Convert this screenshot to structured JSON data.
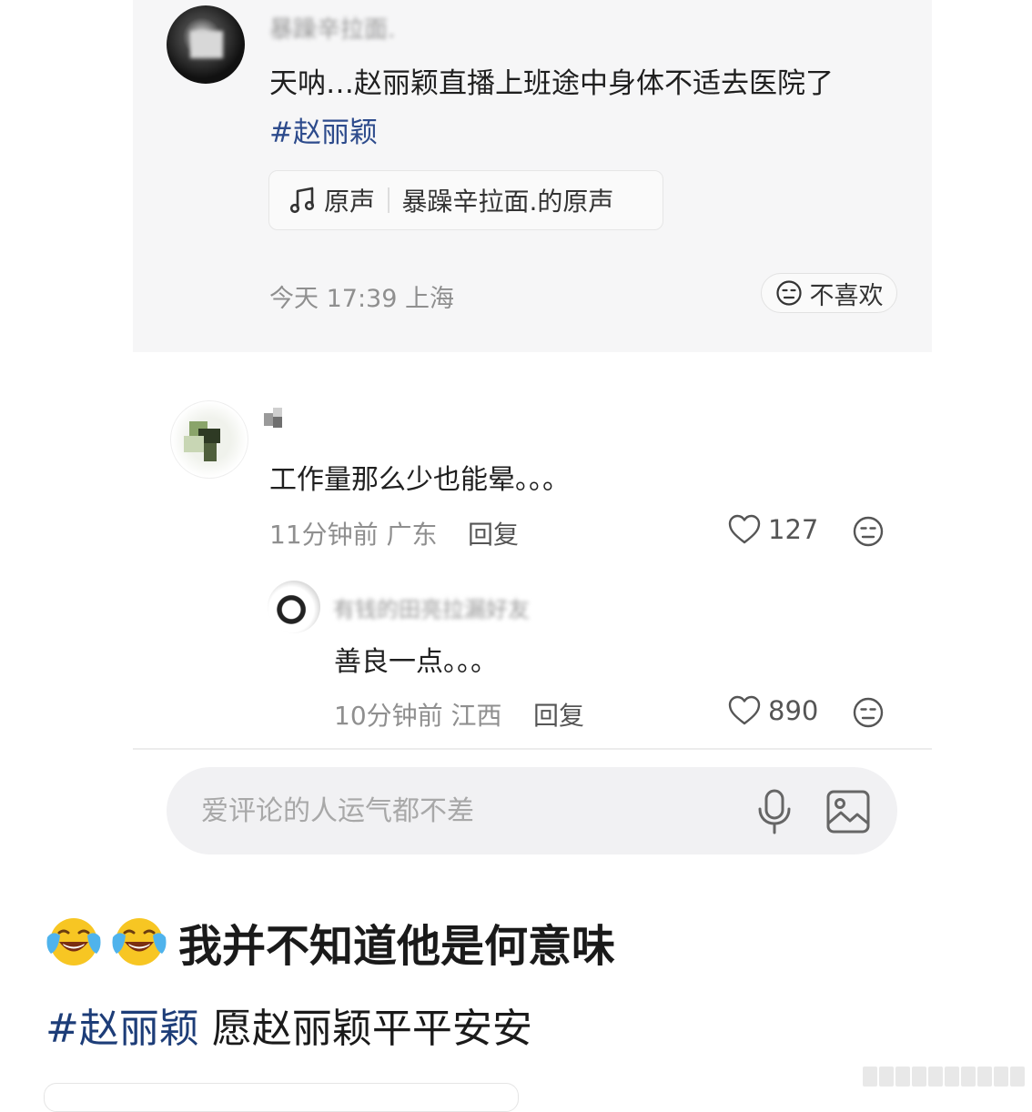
{
  "post": {
    "username": "暴躁辛拉面.",
    "text": "天呐…赵丽颖直播上班途中身体不适去医院了",
    "hashtag": "#赵丽颖",
    "sound_tag": "原声",
    "sound_name": "暴躁辛拉面.的原声",
    "meta": "今天 17:39 上海",
    "dislike_label": "不喜欢"
  },
  "comments": [
    {
      "text": "工作量那么少也能晕。。。",
      "meta": "11分钟前 广东",
      "reply_label": "回复",
      "likes": "127",
      "replies": [
        {
          "username": "有钱的田亮拉漏好友",
          "text": "善良一点。。。",
          "meta": "10分钟前 江西",
          "reply_label": "回复",
          "likes": "890"
        }
      ]
    }
  ],
  "comment_input": {
    "placeholder": "爱评论的人运气都不差"
  },
  "caption": {
    "emoji": [
      "face-with-tears-of-joy",
      "face-with-tears-of-joy"
    ],
    "text": "我并不知道他是何意味"
  },
  "hashtag_line": {
    "tag": "#赵丽颖",
    "text": " 愿赵丽颖平平安安"
  },
  "colors": {
    "hashtag": "#2d4b8c",
    "muted": "#8f8f8f",
    "card_bg": "#f6f6f7"
  }
}
